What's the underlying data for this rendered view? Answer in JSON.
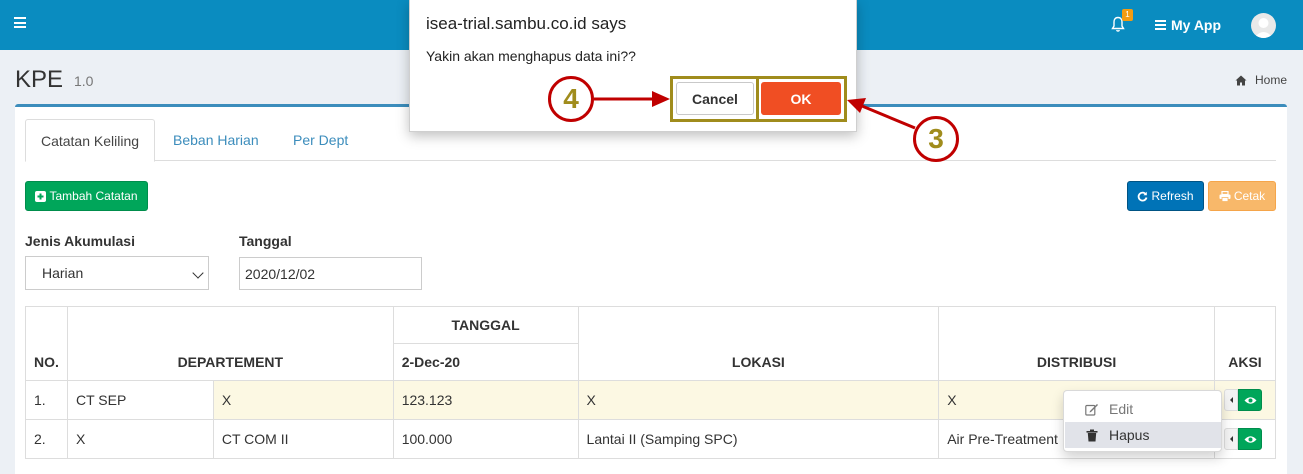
{
  "header": {
    "notification_count": "1",
    "app_menu_label": "My App"
  },
  "page": {
    "title": "KPE",
    "version": "1.0",
    "breadcrumb_home": "Home"
  },
  "tabs": [
    {
      "label": "Catatan Keliling"
    },
    {
      "label": "Beban Harian"
    },
    {
      "label": "Per Dept"
    }
  ],
  "toolbar": {
    "add_label": "Tambah Catatan",
    "refresh_label": "Refresh",
    "print_label": "Cetak"
  },
  "filters": {
    "akumulasi_label": "Jenis Akumulasi",
    "akumulasi_value": "Harian",
    "tanggal_label": "Tanggal",
    "tanggal_value": "2020/12/02"
  },
  "table": {
    "headers": {
      "no": "NO.",
      "departement": "DEPARTEMENT",
      "tanggal_group": "TANGGAL",
      "tanggal_date": "2-Dec-20",
      "lokasi": "LOKASI",
      "distribusi": "DISTRIBUSI",
      "aksi": "AKSI"
    },
    "rows": [
      {
        "no": "1.",
        "dept": "CT SEP",
        "subdept": "X",
        "value": "123.123",
        "lokasi": "X",
        "distribusi": "X"
      },
      {
        "no": "2.",
        "dept": "X",
        "subdept": "CT COM II",
        "value": "100.000",
        "lokasi": "Lantai II (Samping SPC)",
        "distribusi": "Air Pre-Treatment"
      }
    ]
  },
  "action_menu": {
    "edit_label": "Edit",
    "delete_label": "Hapus"
  },
  "dialog": {
    "title": "isea-trial.sambu.co.id says",
    "message": "Yakin akan menghapus data ini??",
    "cancel_label": "Cancel",
    "ok_label": "OK"
  },
  "annotations": {
    "step_ok": "3",
    "step_cancel": "4",
    "marker_color": "#c00000",
    "highlight_color": "#a08c1c"
  }
}
